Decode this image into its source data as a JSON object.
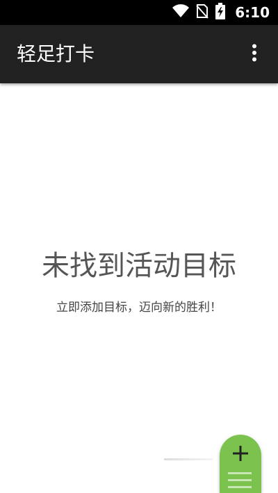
{
  "status_bar": {
    "time": "6:10",
    "icons": [
      "wifi-icon",
      "no-sim-icon",
      "battery-charging-icon"
    ]
  },
  "toolbar": {
    "title": "轻足打卡",
    "menu_icon": "more-vert-icon"
  },
  "empty_state": {
    "title": "未找到活动目标",
    "subtitle": "立即添加目标，迈向新的胜利！"
  },
  "fab": {
    "icon": "plus-icon",
    "color": "#7cc24e"
  },
  "colors": {
    "status_bar": "#000000",
    "toolbar": "#212121",
    "background": "#ffffff",
    "accent": "#7cc24e"
  }
}
